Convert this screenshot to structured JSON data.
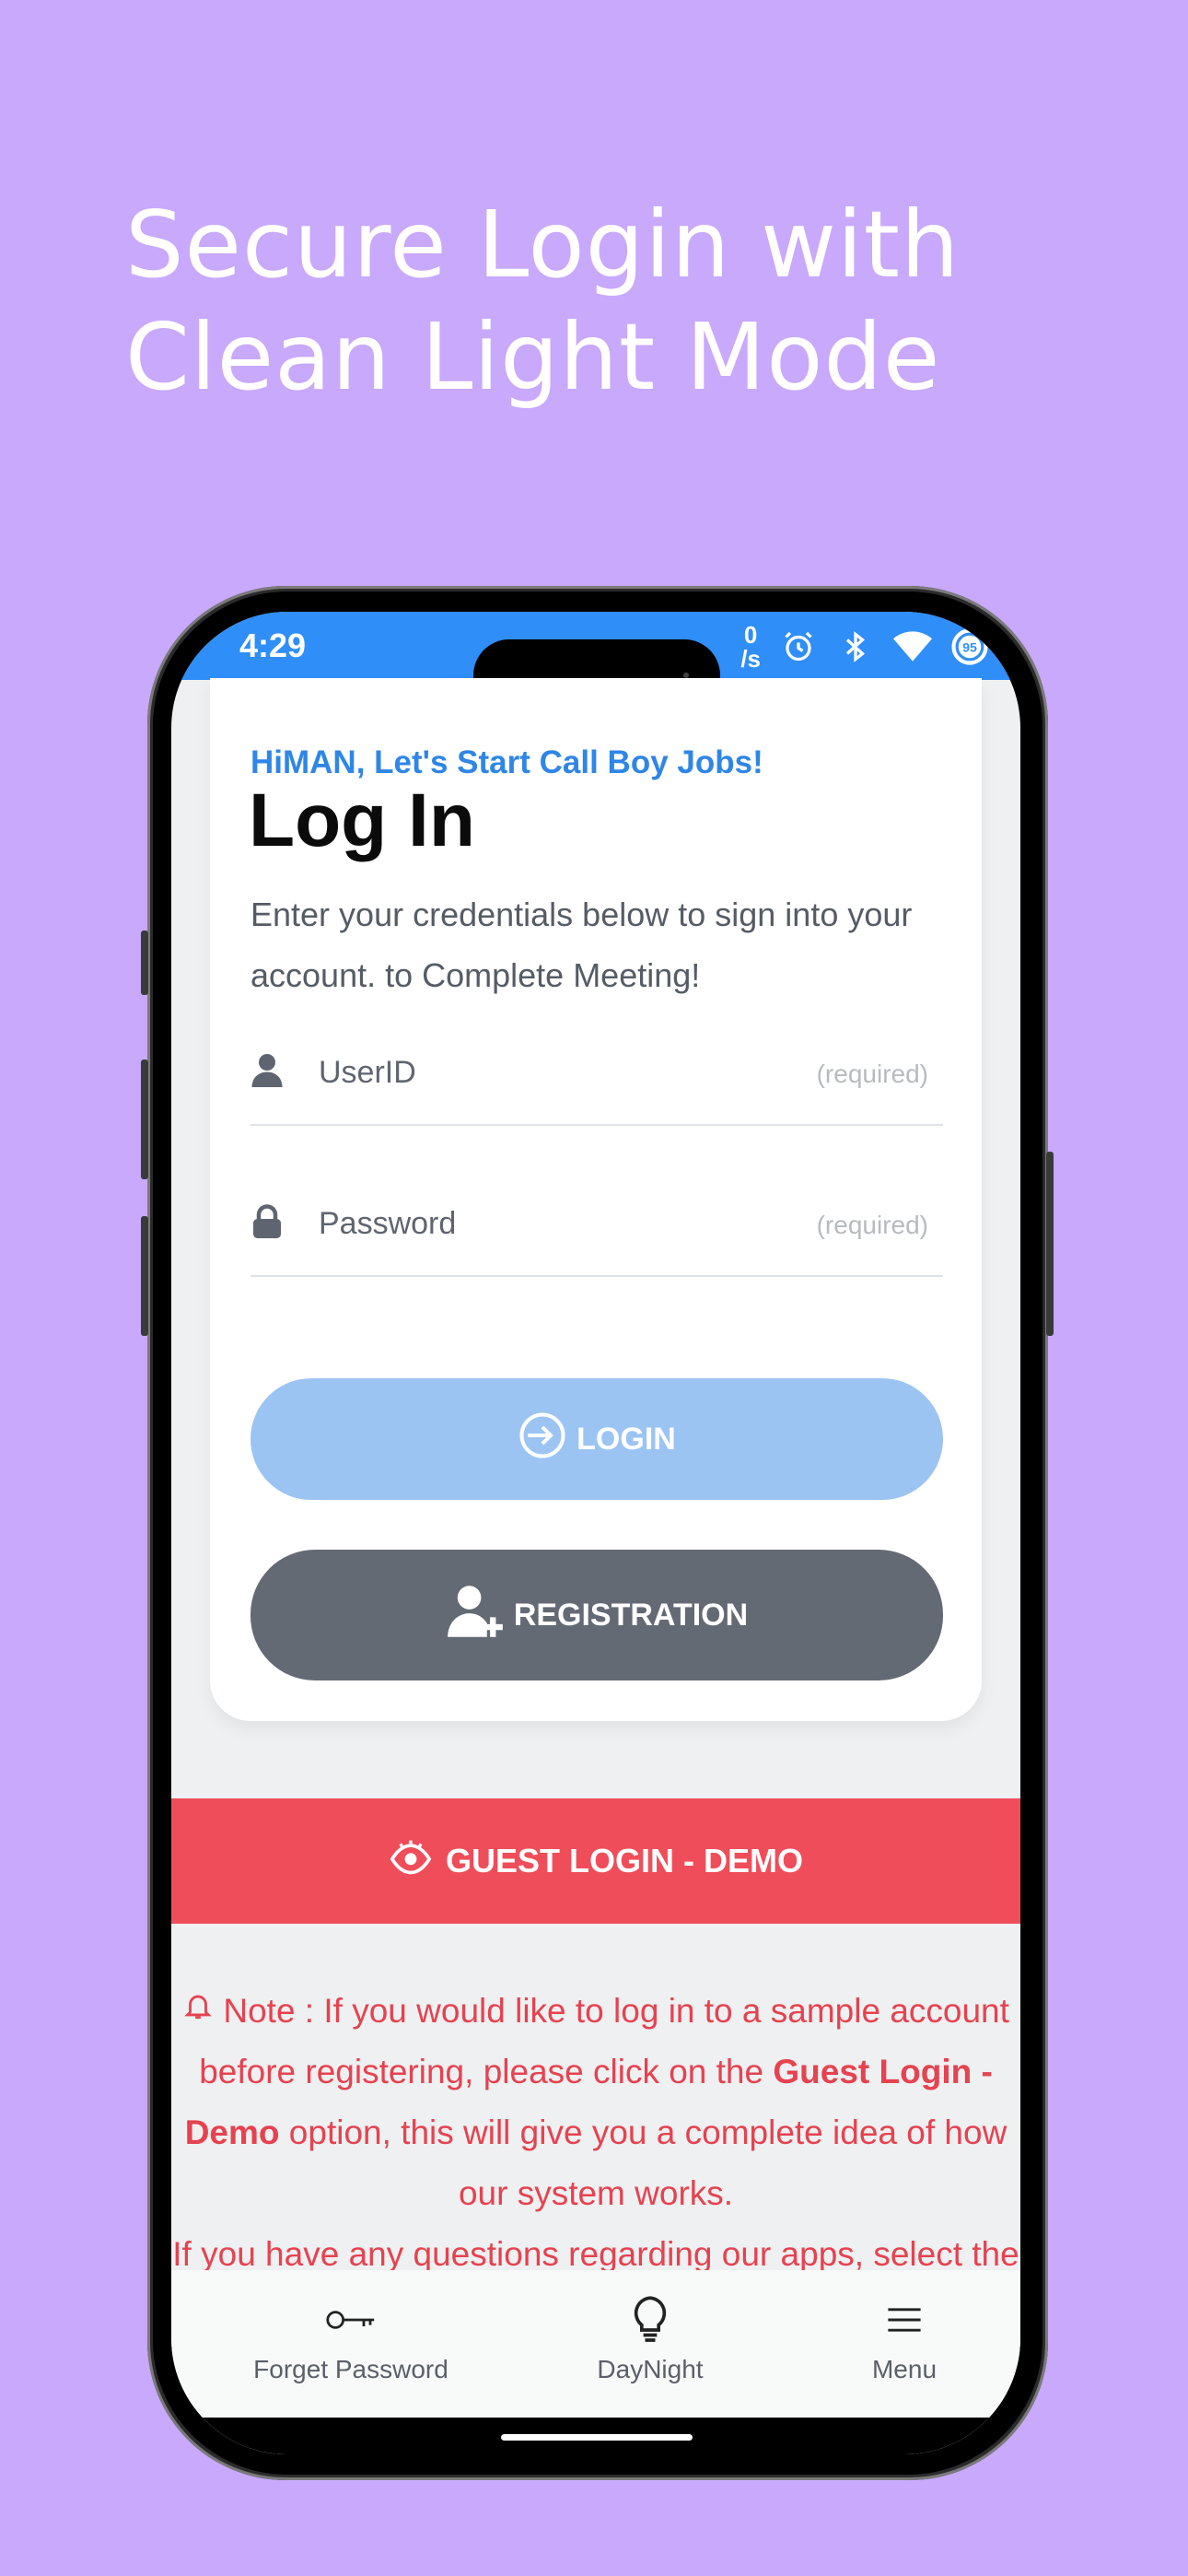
{
  "headline": {
    "line1": "Secure Login with",
    "line2": "Clean Light Mode"
  },
  "status_bar": {
    "time": "4:29",
    "net_speed_value": "0",
    "net_speed_unit": "/s",
    "battery": "95",
    "icons": [
      "alarm-icon",
      "bluetooth-icon",
      "wifi-icon",
      "battery-icon"
    ],
    "color": "#2f8ef8"
  },
  "login_card": {
    "tagline": "HiMAN, Let's Start Call Boy Jobs!",
    "title": "Log In",
    "description": "Enter your credentials below to sign into your account. to Complete Meeting!",
    "userid": {
      "placeholder": "UserID",
      "hint": "(required)",
      "value": ""
    },
    "password": {
      "placeholder": "Password",
      "hint": "(required)",
      "value": ""
    },
    "login_button": "LOGIN",
    "registration_button": "REGISTRATION"
  },
  "guest_button": "GUEST LOGIN - DEMO",
  "note": {
    "prefix": "Note : If you would like to log in to a sample account before registering, please click on the ",
    "highlight": "Guest Login - Demo",
    "suffix": " option, this will give you a complete idea of how our system works.",
    "line2": "If you have any questions regarding our apps, select the"
  },
  "bottom_nav": [
    {
      "label": "Forget Password",
      "icon": "key-icon"
    },
    {
      "label": "DayNight",
      "icon": "lightbulb-icon"
    },
    {
      "label": "Menu",
      "icon": "menu-icon"
    }
  ],
  "colors": {
    "background": "#c8a9fc",
    "primary": "#2f86e6",
    "login_button": "#9cc4f3",
    "registration_button": "#646a74",
    "guest_button": "#f04d5a",
    "note_text": "#e6424f"
  }
}
